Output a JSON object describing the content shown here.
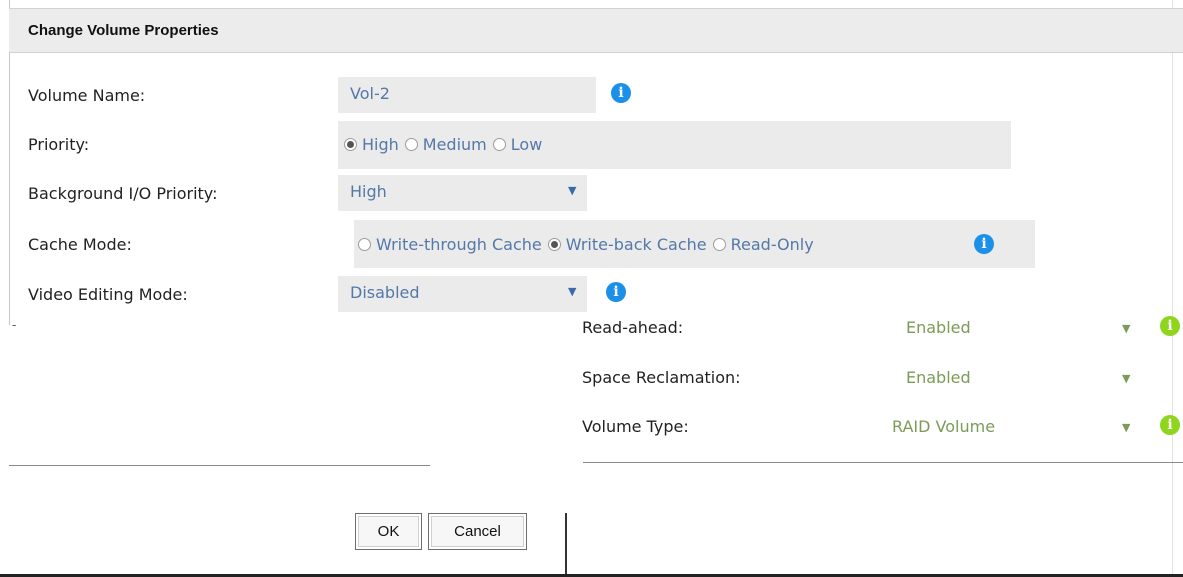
{
  "dialog": {
    "title": "Change Volume Properties"
  },
  "form": {
    "volume_name": {
      "label": "Volume Name:",
      "value": "Vol-2"
    },
    "priority": {
      "label": "Priority:",
      "options": [
        "High",
        "Medium",
        "Low"
      ],
      "selected": "High"
    },
    "background_io_priority": {
      "label": "Background I/O Priority:",
      "value": "High"
    },
    "cache_mode": {
      "label": "Cache Mode:",
      "options": [
        "Write-through Cache",
        "Write-back Cache",
        "Read-Only"
      ],
      "selected": "Write-back Cache"
    },
    "video_editing_mode": {
      "label": "Video Editing Mode:",
      "value": "Disabled"
    }
  },
  "advanced": {
    "read_ahead": {
      "label": "Read-ahead:",
      "value": "Enabled"
    },
    "space_reclamation": {
      "label": "Space Reclamation:",
      "value": "Enabled"
    },
    "volume_type": {
      "label": "Volume Type:",
      "value": "RAID Volume"
    }
  },
  "buttons": {
    "ok": "OK",
    "cancel": "Cancel"
  },
  "icons": {
    "info": "i",
    "dropdown": "▼"
  },
  "colors": {
    "info_blue": "#1b90e8",
    "info_green": "#8fd51c",
    "value_blue": "#5478a8",
    "value_green": "#7c9b57",
    "field_bg": "#ebebeb"
  }
}
